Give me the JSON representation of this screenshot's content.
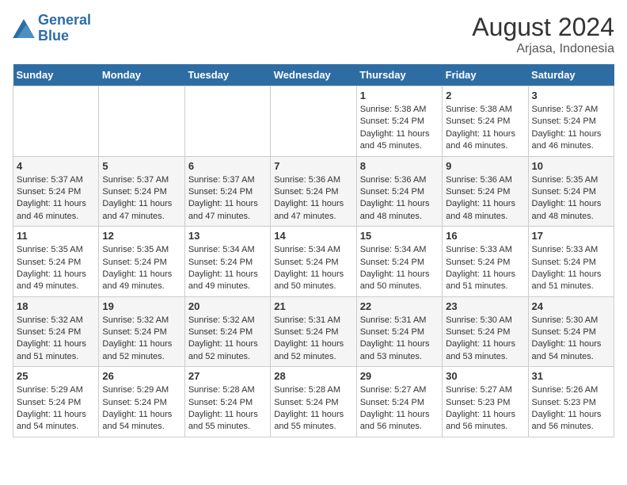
{
  "header": {
    "logo_line1": "General",
    "logo_line2": "Blue",
    "title": "August 2024",
    "subtitle": "Arjasa, Indonesia"
  },
  "days_of_week": [
    "Sunday",
    "Monday",
    "Tuesday",
    "Wednesday",
    "Thursday",
    "Friday",
    "Saturday"
  ],
  "weeks": [
    {
      "days": [
        {
          "number": "",
          "info": ""
        },
        {
          "number": "",
          "info": ""
        },
        {
          "number": "",
          "info": ""
        },
        {
          "number": "",
          "info": ""
        },
        {
          "number": "1",
          "info": "Sunrise: 5:38 AM\nSunset: 5:24 PM\nDaylight: 11 hours and 45 minutes."
        },
        {
          "number": "2",
          "info": "Sunrise: 5:38 AM\nSunset: 5:24 PM\nDaylight: 11 hours and 46 minutes."
        },
        {
          "number": "3",
          "info": "Sunrise: 5:37 AM\nSunset: 5:24 PM\nDaylight: 11 hours and 46 minutes."
        }
      ]
    },
    {
      "days": [
        {
          "number": "4",
          "info": "Sunrise: 5:37 AM\nSunset: 5:24 PM\nDaylight: 11 hours and 46 minutes."
        },
        {
          "number": "5",
          "info": "Sunrise: 5:37 AM\nSunset: 5:24 PM\nDaylight: 11 hours and 47 minutes."
        },
        {
          "number": "6",
          "info": "Sunrise: 5:37 AM\nSunset: 5:24 PM\nDaylight: 11 hours and 47 minutes."
        },
        {
          "number": "7",
          "info": "Sunrise: 5:36 AM\nSunset: 5:24 PM\nDaylight: 11 hours and 47 minutes."
        },
        {
          "number": "8",
          "info": "Sunrise: 5:36 AM\nSunset: 5:24 PM\nDaylight: 11 hours and 48 minutes."
        },
        {
          "number": "9",
          "info": "Sunrise: 5:36 AM\nSunset: 5:24 PM\nDaylight: 11 hours and 48 minutes."
        },
        {
          "number": "10",
          "info": "Sunrise: 5:35 AM\nSunset: 5:24 PM\nDaylight: 11 hours and 48 minutes."
        }
      ]
    },
    {
      "days": [
        {
          "number": "11",
          "info": "Sunrise: 5:35 AM\nSunset: 5:24 PM\nDaylight: 11 hours and 49 minutes."
        },
        {
          "number": "12",
          "info": "Sunrise: 5:35 AM\nSunset: 5:24 PM\nDaylight: 11 hours and 49 minutes."
        },
        {
          "number": "13",
          "info": "Sunrise: 5:34 AM\nSunset: 5:24 PM\nDaylight: 11 hours and 49 minutes."
        },
        {
          "number": "14",
          "info": "Sunrise: 5:34 AM\nSunset: 5:24 PM\nDaylight: 11 hours and 50 minutes."
        },
        {
          "number": "15",
          "info": "Sunrise: 5:34 AM\nSunset: 5:24 PM\nDaylight: 11 hours and 50 minutes."
        },
        {
          "number": "16",
          "info": "Sunrise: 5:33 AM\nSunset: 5:24 PM\nDaylight: 11 hours and 51 minutes."
        },
        {
          "number": "17",
          "info": "Sunrise: 5:33 AM\nSunset: 5:24 PM\nDaylight: 11 hours and 51 minutes."
        }
      ]
    },
    {
      "days": [
        {
          "number": "18",
          "info": "Sunrise: 5:32 AM\nSunset: 5:24 PM\nDaylight: 11 hours and 51 minutes."
        },
        {
          "number": "19",
          "info": "Sunrise: 5:32 AM\nSunset: 5:24 PM\nDaylight: 11 hours and 52 minutes."
        },
        {
          "number": "20",
          "info": "Sunrise: 5:32 AM\nSunset: 5:24 PM\nDaylight: 11 hours and 52 minutes."
        },
        {
          "number": "21",
          "info": "Sunrise: 5:31 AM\nSunset: 5:24 PM\nDaylight: 11 hours and 52 minutes."
        },
        {
          "number": "22",
          "info": "Sunrise: 5:31 AM\nSunset: 5:24 PM\nDaylight: 11 hours and 53 minutes."
        },
        {
          "number": "23",
          "info": "Sunrise: 5:30 AM\nSunset: 5:24 PM\nDaylight: 11 hours and 53 minutes."
        },
        {
          "number": "24",
          "info": "Sunrise: 5:30 AM\nSunset: 5:24 PM\nDaylight: 11 hours and 54 minutes."
        }
      ]
    },
    {
      "days": [
        {
          "number": "25",
          "info": "Sunrise: 5:29 AM\nSunset: 5:24 PM\nDaylight: 11 hours and 54 minutes."
        },
        {
          "number": "26",
          "info": "Sunrise: 5:29 AM\nSunset: 5:24 PM\nDaylight: 11 hours and 54 minutes."
        },
        {
          "number": "27",
          "info": "Sunrise: 5:28 AM\nSunset: 5:24 PM\nDaylight: 11 hours and 55 minutes."
        },
        {
          "number": "28",
          "info": "Sunrise: 5:28 AM\nSunset: 5:24 PM\nDaylight: 11 hours and 55 minutes."
        },
        {
          "number": "29",
          "info": "Sunrise: 5:27 AM\nSunset: 5:24 PM\nDaylight: 11 hours and 56 minutes."
        },
        {
          "number": "30",
          "info": "Sunrise: 5:27 AM\nSunset: 5:23 PM\nDaylight: 11 hours and 56 minutes."
        },
        {
          "number": "31",
          "info": "Sunrise: 5:26 AM\nSunset: 5:23 PM\nDaylight: 11 hours and 56 minutes."
        }
      ]
    }
  ]
}
